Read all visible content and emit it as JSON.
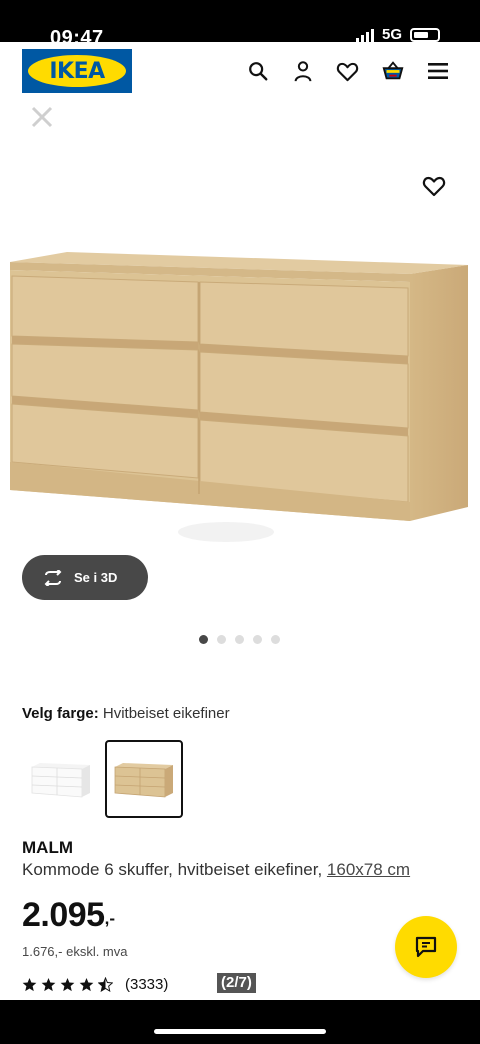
{
  "status_bar": {
    "time": "09:47",
    "network": "5G"
  },
  "header": {
    "logo_text": "IKEA",
    "icons": [
      "search-icon",
      "user-icon",
      "heart-icon",
      "basket-icon",
      "menu-icon"
    ]
  },
  "gallery": {
    "see_3d_label": "Se i 3D",
    "image_count": 5,
    "active_index": 0
  },
  "color_selector": {
    "label": "Velg farge:",
    "value": "Hvitbeiset eikefiner",
    "options": [
      "white",
      "white-stained-oak"
    ],
    "selected_index": 1
  },
  "product": {
    "name": "MALM",
    "description": "Kommode 6 skuffer, hvitbeiset eikefiner,",
    "size": "160x78 cm",
    "price": "2.095",
    "price_suffix": ",-",
    "price_ex_vat": "1.676,- ekskl. mva",
    "rating_stars": 4.5,
    "rating_count": "(3333)"
  },
  "overlay_badge": "(2/7)",
  "colors": {
    "ikea_blue": "#0058a3",
    "ikea_yellow": "#ffdb00",
    "dark_grey": "#484848",
    "oak": "#dcc394"
  }
}
